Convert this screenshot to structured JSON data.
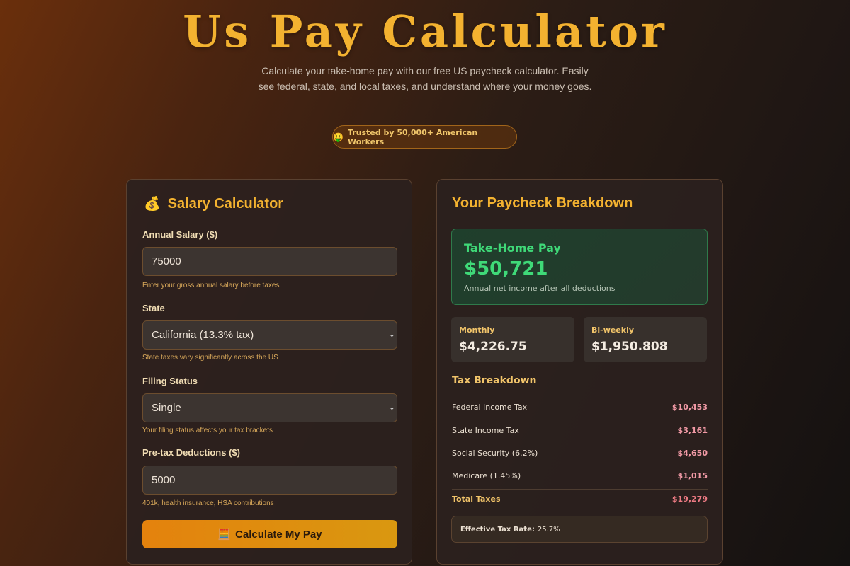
{
  "hero": {
    "title": "Us Pay Calculator",
    "subtitle": "Calculate your take-home pay with our free US paycheck calculator. Easily see federal, state, and local taxes, and understand where your money goes.",
    "badge_icon": "🤑",
    "badge_text": "Trusted by 50,000+ American Workers"
  },
  "form": {
    "icon": "💰",
    "title": "Salary Calculator",
    "annual_salary": {
      "label": "Annual Salary ($)",
      "value": "75000",
      "help": "Enter your gross annual salary before taxes"
    },
    "state": {
      "label": "State",
      "selected": "California (13.3% tax)",
      "help": "State taxes vary significantly across the US"
    },
    "filing_status": {
      "label": "Filing Status",
      "selected": "Single",
      "help": "Your filing status affects your tax brackets"
    },
    "pretax": {
      "label": "Pre-tax Deductions ($)",
      "value": "5000",
      "help": "401k, health insurance, HSA contributions"
    },
    "button_icon": "🧮",
    "button_label": "Calculate My Pay"
  },
  "results": {
    "title": "Your Paycheck Breakdown",
    "take_home": {
      "label": "Take-Home Pay",
      "value": "$50,721",
      "note": "Annual net income after all deductions"
    },
    "monthly": {
      "label": "Monthly",
      "value": "$4,226.75"
    },
    "biweekly": {
      "label": "Bi-weekly",
      "value": "$1,950.808"
    },
    "tax_breakdown_title": "Tax Breakdown",
    "taxes": [
      {
        "name": "Federal Income Tax",
        "amount": "$10,453"
      },
      {
        "name": "State Income Tax",
        "amount": "$3,161"
      },
      {
        "name": "Social Security (6.2%)",
        "amount": "$4,650"
      },
      {
        "name": "Medicare (1.45%)",
        "amount": "$1,015"
      }
    ],
    "total": {
      "name": "Total Taxes",
      "amount": "$19,279"
    },
    "effective": {
      "label": "Effective Tax Rate:",
      "value": "25.7%"
    }
  },
  "colors": {
    "accent": "#f3b230",
    "success": "#3fd978",
    "tax_amount": "#f29aa6"
  }
}
